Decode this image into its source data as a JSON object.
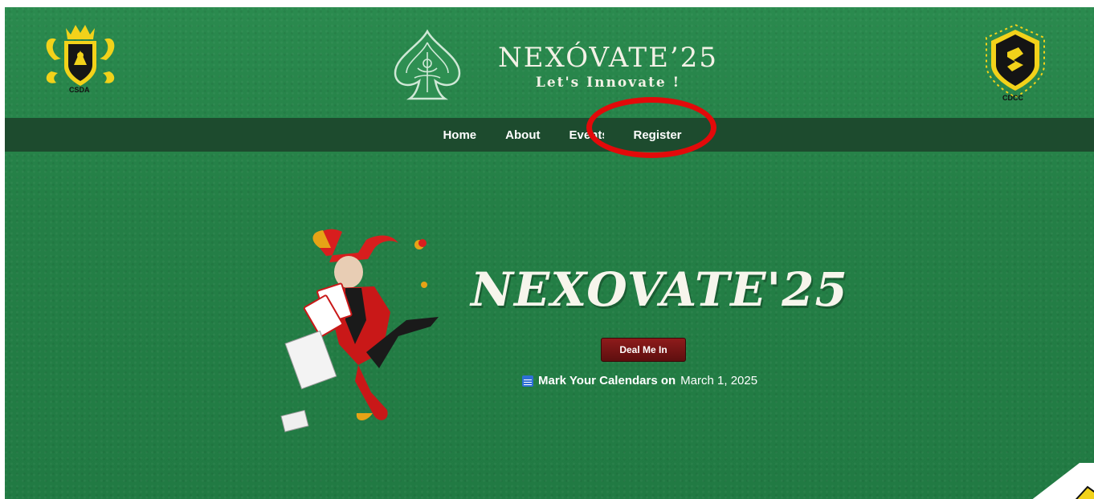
{
  "header": {
    "left_logo": {
      "icon": "csda-crest-icon",
      "caption": "CSDA"
    },
    "brand_title": "NEXÓVATE’25",
    "tagline": "Let's Innovate !",
    "spade_icon": "ornate-spade-icon",
    "right_logo": {
      "icon": "cdcc-shield-icon",
      "caption": "CDCC"
    }
  },
  "nav": {
    "items": [
      {
        "label": "Home"
      },
      {
        "label": "About"
      },
      {
        "label": "Events"
      },
      {
        "label": "Register"
      }
    ]
  },
  "hero": {
    "title": "NEXOVATE'25",
    "cta_label": "Deal Me In",
    "date_prefix": "Mark Your Calendars on",
    "date_value": "March 1, 2025",
    "illustration": "joker-with-cards-icon"
  },
  "colors": {
    "felt_green": "#247f46",
    "nav_bar": "#1d4b2e",
    "cta_red": "#7a1515",
    "annotation_red": "#e20a0a",
    "gold": "#f2d21a"
  }
}
